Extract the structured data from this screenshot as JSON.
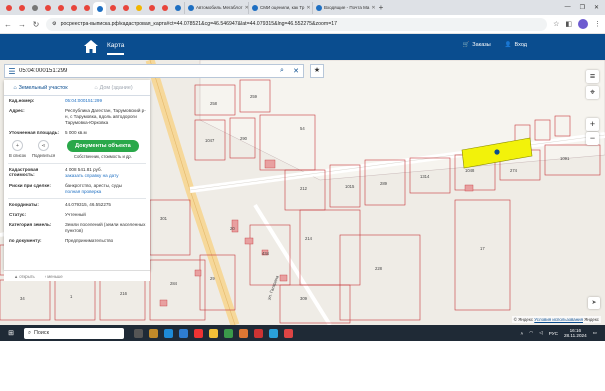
{
  "browser": {
    "tabs": [
      {
        "label": "",
        "color": "#e8453c"
      },
      {
        "label": "",
        "color": "#e8453c"
      },
      {
        "label": "",
        "color": "#777777"
      },
      {
        "label": "",
        "color": "#e8453c"
      },
      {
        "label": "",
        "color": "#e8453c"
      },
      {
        "label": "",
        "color": "#e8453c"
      },
      {
        "label": "",
        "color": "#e8453c"
      },
      {
        "label": "",
        "color": "#1e6fc2",
        "active": true
      },
      {
        "label": "",
        "color": "#e8453c"
      },
      {
        "label": "",
        "color": "#e8453c"
      },
      {
        "label": "",
        "color": "#f2b600"
      },
      {
        "label": "",
        "color": "#e8453c"
      },
      {
        "label": "",
        "color": "#e8453c"
      },
      {
        "label": "",
        "color": "#1e6fc2"
      },
      {
        "label": "Автомобиль Мегаблот",
        "color": "#1e6fc2"
      },
      {
        "label": "СМИ оценили, как Тр",
        "color": "#1e6fc2"
      },
      {
        "label": "Входящие - Почта Ма",
        "color": "#1e6fc2"
      }
    ],
    "url": "росреестра-выписка.рф/кадастровая_карта#ct=44.078521&cg=46.546947&lat=44.079315&lng=46.552275&zoom=17"
  },
  "header": {
    "map_link": "Карта",
    "orders": "Заказы",
    "login": "Вход"
  },
  "search": {
    "value": "05:04:000151:299"
  },
  "panel": {
    "tab_land": "Земельный участок",
    "tab_building": "Дом (здание)",
    "rows_top": [
      {
        "label": "Кад.номер:",
        "value": "05:04:000151:299",
        "link": true
      },
      {
        "label": "Адрес:",
        "value": "Республика Дагестан, Тарумовский р-н, с Тарумовка, вдоль автодороги Тарумовка-Юрковка",
        "link": false
      },
      {
        "label": "Уточненная площадь:",
        "value": "5 000 кв.м",
        "link": false
      }
    ],
    "actions": {
      "to_list": "В список",
      "share": "Поделиться",
      "docs_button": "Документы объекта",
      "docs_sub": "Собственник, стоимость и др."
    },
    "cost": {
      "label": "Кадастровая стоимость:",
      "value": "4 008 541.81 руб.",
      "link": "заказать справку на дату"
    },
    "risk": {
      "label": "Риски при сделке:",
      "value": "банкротство, аресты, суды",
      "link": "полная проверка"
    },
    "rows_bottom": [
      {
        "label": "Координаты:",
        "value": "44.079315, 46.552275"
      },
      {
        "label": "Статус:",
        "value": "Учтенный"
      },
      {
        "label": "Категория земель:",
        "value": "Земли поселений (земли населенных пунктов)"
      },
      {
        "label": "по документу:",
        "value": "Предпринимательство"
      }
    ],
    "bottom": {
      "item1": "▲ открыть",
      "item2": "‹ меньше"
    }
  },
  "map": {
    "parcel_labels": [
      "258",
      "259",
      "1047",
      "290",
      "54",
      "274",
      "212",
      "1015",
      "289",
      "1314",
      "1048",
      "1091",
      "214",
      "228",
      "434",
      "309",
      "301",
      "284",
      "271",
      "278",
      "274",
      "34",
      "1",
      "216",
      "29",
      "17",
      "20"
    ],
    "street_label": "ул. Гагарина",
    "highlight_color": "#f2f20a",
    "copyright": "© Яндекс",
    "terms": "Условия использования",
    "brand": "Яндекс"
  },
  "taskbar": {
    "search": "Поиск",
    "lang": "РУС",
    "time": "16:16",
    "date": "28.11.2024"
  }
}
